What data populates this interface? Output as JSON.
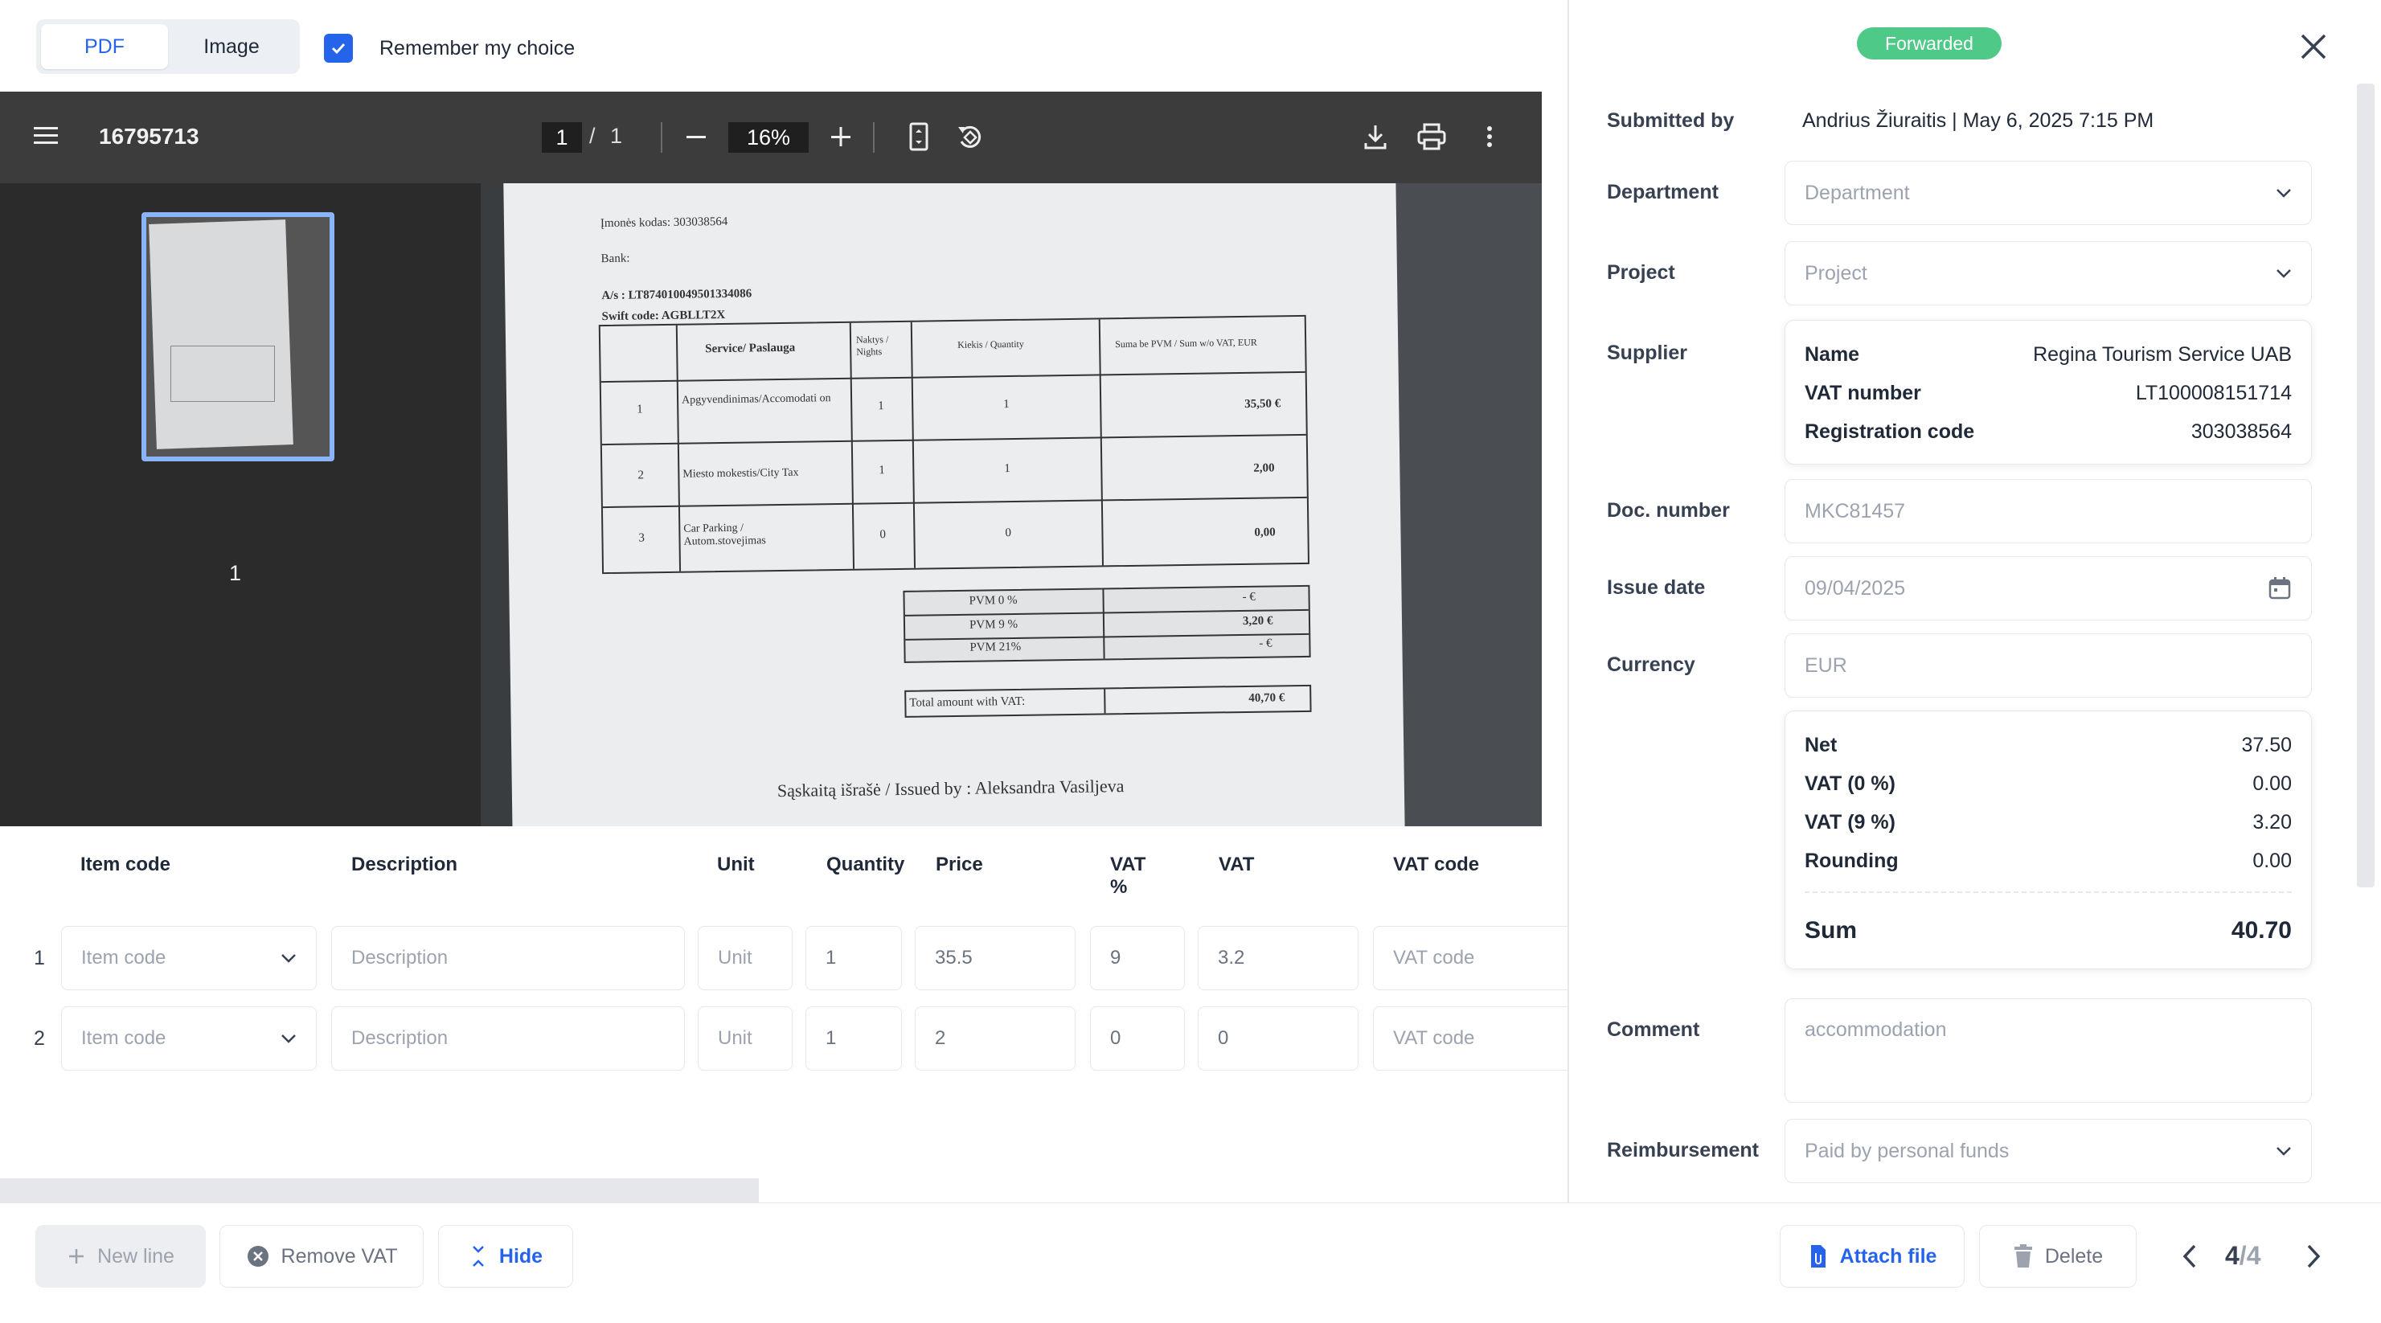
{
  "toggle": {
    "pdf": "PDF",
    "image": "Image"
  },
  "remember_label": "Remember my choice",
  "viewer": {
    "doc_id": "16795713",
    "page_current": "1",
    "page_sep": "/",
    "page_total": "1",
    "zoom": "16%",
    "thumb_label": "1"
  },
  "invoice": {
    "company_code": "Įmonės kodas:  303038564",
    "bank": "Bank:",
    "account": "A/s : LT874010049501334086",
    "swift": "Swift code: AGBLLT2X",
    "headers": [
      "Service/ Paslauga",
      "Naktys / Nights",
      "Kiekis / Quantity",
      "Suma be PVM / Sum w/o VAT, EUR"
    ],
    "rows": [
      {
        "n": "1",
        "service": "Apgyvendinimas/Accomodati on",
        "nights": "1",
        "qty": "1",
        "sum": "35,50 €"
      },
      {
        "n": "2",
        "service": "Miesto mokestis/City Tax",
        "nights": "1",
        "qty": "1",
        "sum": "2,00"
      },
      {
        "n": "3",
        "service": "Car Parking  / Autom.stovejimas",
        "nights": "0",
        "qty": "0",
        "sum": "0,00"
      }
    ],
    "vat": [
      {
        "label": "PVM 0 %",
        "val": "-    €"
      },
      {
        "label": "PVM  9 %",
        "val": "3,20 €"
      },
      {
        "label": "PVM  21%",
        "val": "-  €"
      }
    ],
    "total_label": "Total amount with VAT:",
    "total_val": "40,70 €",
    "issued": "Sąskaitą išrašė / Issued by : Aleksandra Vasiljeva"
  },
  "table": {
    "headers": [
      "Item code",
      "Description",
      "Unit",
      "Quantity",
      "Price",
      "VAT %",
      "VAT",
      "VAT code"
    ],
    "rows": [
      {
        "num": "1",
        "item_code": "Item code",
        "description": "Description",
        "unit": "Unit",
        "quantity": "1",
        "price": "35.5",
        "vat_pct": "9",
        "vat": "3.2",
        "vat_code": "VAT code"
      },
      {
        "num": "2",
        "item_code": "Item code",
        "description": "Description",
        "unit": "Unit",
        "quantity": "1",
        "price": "2",
        "vat_pct": "0",
        "vat": "0",
        "vat_code": "VAT code"
      }
    ]
  },
  "status_badge": "Forwarded",
  "details": {
    "submitted_label": "Submitted by",
    "submitted_value": "Andrius Žiuraitis   |   May 6, 2025 7:15 PM",
    "department_label": "Department",
    "department_placeholder": "Department",
    "project_label": "Project",
    "project_placeholder": "Project",
    "supplier_label": "Supplier",
    "supplier": {
      "name_k": "Name",
      "name_v": "Regina Tourism Service UAB",
      "vat_k": "VAT number",
      "vat_v": "LT100008151714",
      "reg_k": "Registration code",
      "reg_v": "303038564"
    },
    "docnum_label": "Doc. number",
    "docnum_value": "MKC81457",
    "issue_label": "Issue date",
    "issue_value": "09/04/2025",
    "currency_label": "Currency",
    "currency_value": "EUR",
    "totals": {
      "net_k": "Net",
      "net_v": "37.50",
      "vat0_k": "VAT (0 %)",
      "vat0_v": "0.00",
      "vat9_k": "VAT (9 %)",
      "vat9_v": "3.20",
      "round_k": "Rounding",
      "round_v": "0.00",
      "sum_k": "Sum",
      "sum_v": "40.70"
    },
    "comment_label": "Comment",
    "comment_value": "accommodation",
    "reimb_label": "Reimbursement",
    "reimb_value": "Paid by personal funds"
  },
  "footer": {
    "new_line": "New line",
    "remove_vat": "Remove VAT",
    "hide": "Hide",
    "attach": "Attach file",
    "delete": "Delete",
    "pager_current": "4",
    "pager_total": "/4"
  },
  "colors": {
    "accent": "#2563eb",
    "badge": "#4fc987",
    "viewer_bg": "#323639"
  }
}
